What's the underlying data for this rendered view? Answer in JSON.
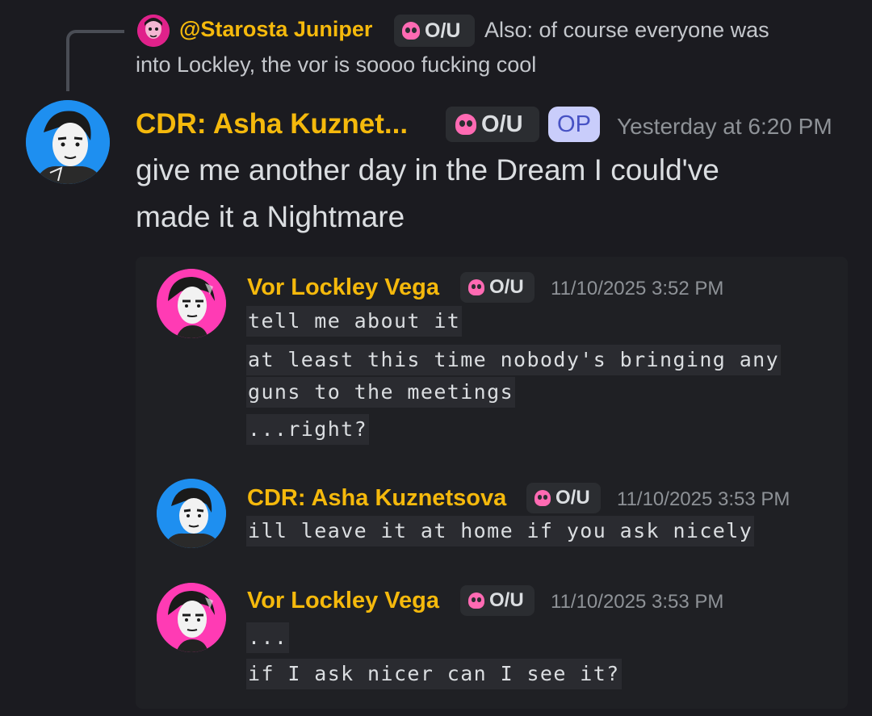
{
  "reply": {
    "author": "@Starosta Juniper",
    "tag": "O/U",
    "text_line1": "Also: of course everyone was",
    "text_line2": "into Lockley, the vor is soooo fucking cool"
  },
  "main_message": {
    "author": "CDR: Asha Kuznet...",
    "tag": "O/U",
    "op_badge": "OP",
    "timestamp": "Yesterday at 6:20 PM",
    "text_line1": "give me another day in the Dream I could've",
    "text_line2": "made it a Nightmare"
  },
  "thread": [
    {
      "author": "Vor Lockley Vega",
      "tag": "O/U",
      "timestamp": "11/10/2025 3:52 PM",
      "lines": [
        "tell me about it",
        "at least this time nobody's bringing any",
        "guns to the meetings",
        "...right?"
      ]
    },
    {
      "author": "CDR: Asha Kuznetsova",
      "tag": "O/U",
      "timestamp": "11/10/2025 3:53 PM",
      "lines": [
        "ill leave it at home if you ask nicely "
      ]
    },
    {
      "author": "Vor Lockley Vega",
      "tag": "O/U",
      "timestamp": "11/10/2025 3:53 PM",
      "lines": [
        "...",
        "if I ask nicer can I see it?"
      ]
    }
  ],
  "colors": {
    "background": "#1b1b20",
    "name": "#f5b90c",
    "timestamp": "#8e9297",
    "tag_bg": "#2b2d31",
    "skull": "#ff6ab3",
    "op_badge_bg": "#c9cdfb",
    "op_badge_text": "#4752c4",
    "asha_avatar_bg": "#1e8ff0",
    "lockley_avatar_bg": "#ff3bb4"
  }
}
